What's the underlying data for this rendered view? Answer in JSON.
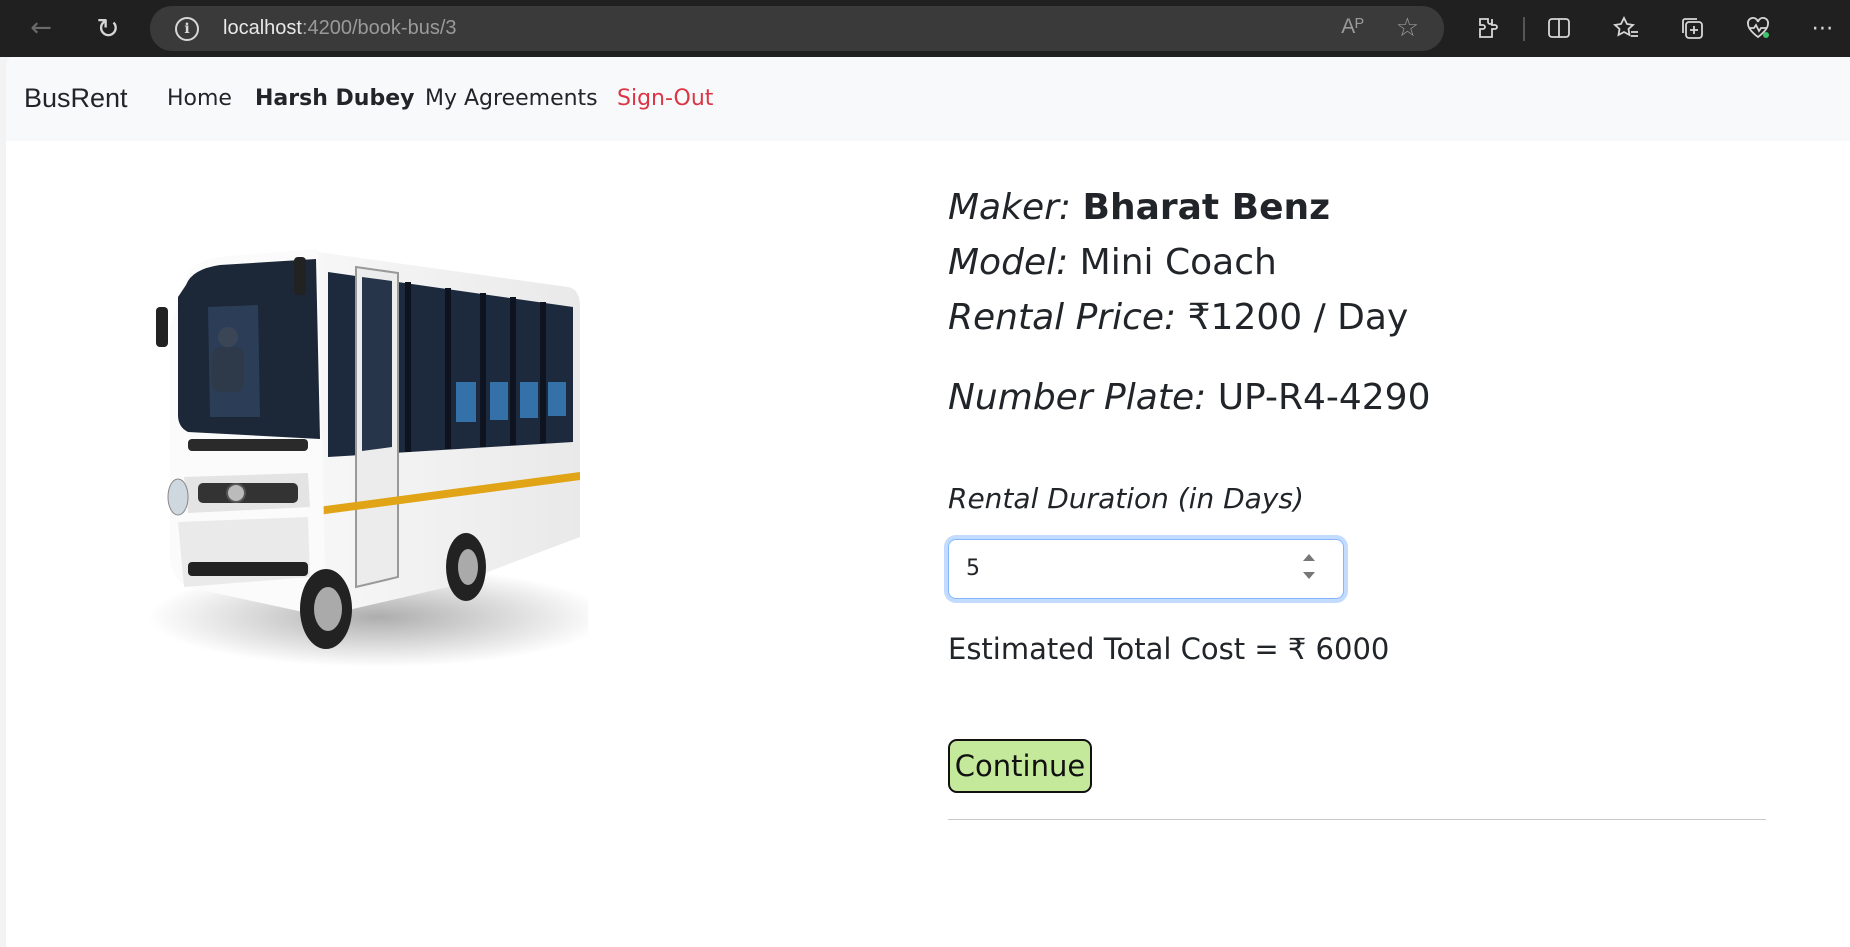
{
  "browser": {
    "url_host": "localhost",
    "url_path": ":4200/book-bus/3",
    "read_aloud_label": "Aᴾ"
  },
  "navbar": {
    "brand": "BusRent",
    "home": "Home",
    "user": "Harsh Dubey",
    "agreements": "My Agreements",
    "signout": "Sign-Out"
  },
  "bus": {
    "maker_label": "Maker:",
    "maker": "Bharat Benz",
    "model_label": "Model:",
    "model": "Mini Coach",
    "price_label": "Rental Price:",
    "price": "₹1200 / Day",
    "plate_label": "Number Plate:",
    "plate": "UP-R4-4290"
  },
  "booking": {
    "duration_label": "Rental Duration (in Days)",
    "duration_value": "5",
    "total": "Estimated Total Cost = ₹ 6000",
    "continue_label": "Continue"
  },
  "colors": {
    "signout": "#dc3545",
    "continue_bg": "#c5e99b",
    "bus_stripe": "#e0a416"
  }
}
